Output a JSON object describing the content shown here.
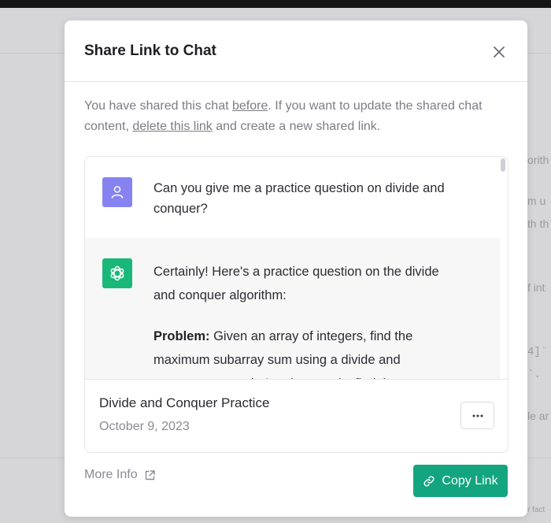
{
  "modal": {
    "title": "Share Link to Chat",
    "description": {
      "part1": "You have shared this chat ",
      "link_before": "before",
      "part2": ". If you want to update the shared chat content, ",
      "link_delete": "delete this link",
      "part3": " and create a new shared link."
    }
  },
  "conversation": {
    "user_message": "Can you give me a practice question on divide and conquer?",
    "assistant_intro": "Certainly! Here's a practice question on the divide and conquer algorithm:",
    "assistant_problem_label": "Problem:",
    "assistant_problem_text": " Given an array of integers, find the maximum subarray sum using a divide and conquer approach. In other words, find the"
  },
  "footer": {
    "chat_title": "Divide and Conquer Practice",
    "chat_date": "October 9, 2023",
    "more_label": "···"
  },
  "actions": {
    "more_info_label": "More Info",
    "copy_link_label": "Copy Link"
  },
  "background": {
    "snippets": [
      "orith",
      "m u",
      "th th",
      "f int",
      "4]`",
      "`.",
      "le ar",
      "r fact"
    ]
  },
  "colors": {
    "accent": "#13a480",
    "user_avatar": "#8683f1",
    "bot_avatar": "#19b879"
  },
  "icons": {
    "close": "close-icon",
    "user": "user-icon",
    "bot": "openai-logo-icon",
    "external": "external-link-icon",
    "link": "link-icon"
  }
}
